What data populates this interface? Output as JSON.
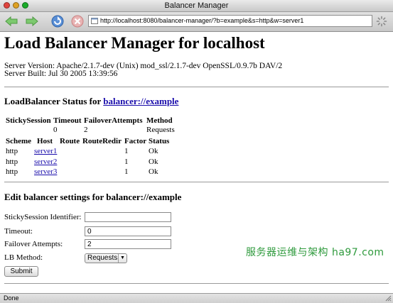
{
  "window": {
    "title": "Balancer Manager",
    "url": "http://localhost:8080/balancer-manager/?b=example&s=http&w=server1",
    "status": "Done"
  },
  "toolbar": {
    "icons": [
      "back-arrow-icon",
      "forward-arrow-icon",
      "reload-icon",
      "stop-icon",
      "page-icon",
      "spinner-icon"
    ]
  },
  "page": {
    "title": "Load Balancer Manager for localhost",
    "server_version": "Server Version: Apache/2.1.7-dev (Unix) mod_ssl/2.1.7-dev OpenSSL/0.9.7b DAV/2",
    "server_built": "Server Built: Jul 30 2005 13:39:56",
    "status_heading_prefix": "LoadBalancer Status for ",
    "balancer_link": "balancer://example"
  },
  "balancer_table": {
    "headers": [
      "StickySession",
      "Timeout",
      "FailoverAttempts",
      "Method"
    ],
    "values": [
      "",
      "0",
      "2",
      "Requests"
    ]
  },
  "worker_table": {
    "headers": [
      "Scheme",
      "Host",
      "Route",
      "RouteRedir",
      "Factor",
      "Status"
    ],
    "rows": [
      {
        "scheme": "http",
        "host": "server1",
        "route": "",
        "redir": "",
        "factor": "1",
        "status": "Ok"
      },
      {
        "scheme": "http",
        "host": "server2",
        "route": "",
        "redir": "",
        "factor": "1",
        "status": "Ok"
      },
      {
        "scheme": "http",
        "host": "server3",
        "route": "",
        "redir": "",
        "factor": "1",
        "status": "Ok"
      }
    ]
  },
  "edit_form": {
    "heading": "Edit balancer settings for balancer://example",
    "sticky_label": "StickySession Identifier:",
    "sticky_value": "",
    "timeout_label": "Timeout:",
    "timeout_value": "0",
    "failover_label": "Failover Attempts:",
    "failover_value": "2",
    "lbmethod_label": "LB Method:",
    "lbmethod_value": "Requests",
    "submit_label": "Submit"
  },
  "watermark": "服务器运维与架构 ha97.com",
  "colors": {
    "link": "#1a0dab",
    "watermark": "#2e9a3c",
    "close": "#e0443e",
    "minimize": "#dea123",
    "zoom": "#1aab29"
  }
}
